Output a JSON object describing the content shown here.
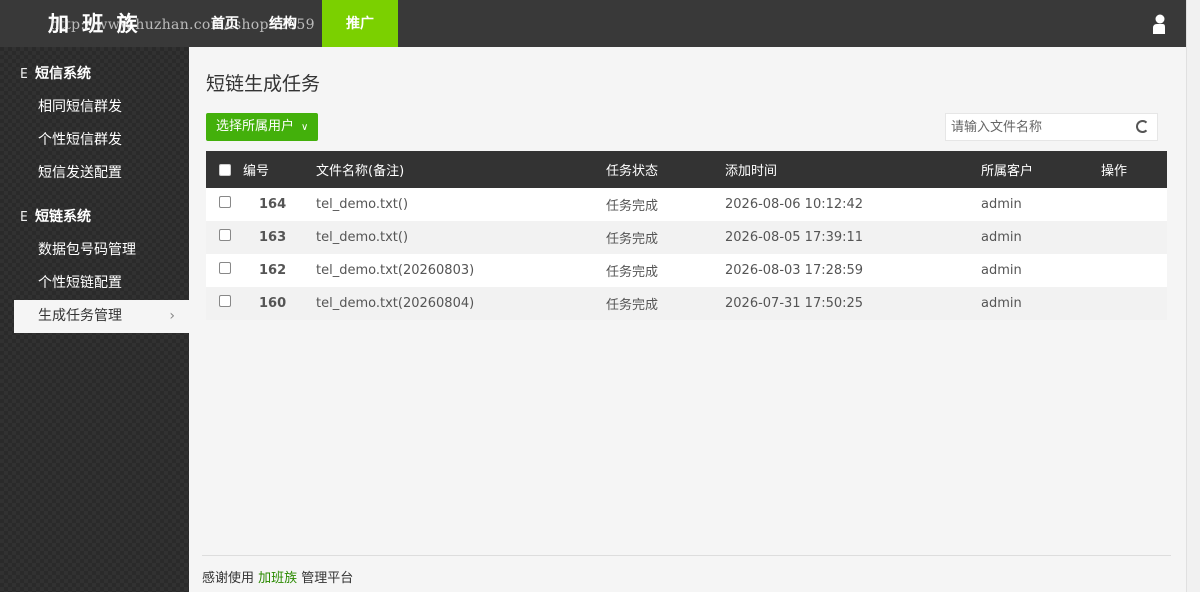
{
  "header": {
    "logo": "加 班 族",
    "watermark": "http://www.huzhan.com/ishop32059",
    "nav": [
      "首页",
      "结构",
      "推广"
    ],
    "active_nav": "推广"
  },
  "sidebar": {
    "groups": [
      {
        "icon": "E",
        "title": "短信系统",
        "items": [
          "相同短信群发",
          "个性短信群发",
          "短信发送配置"
        ]
      },
      {
        "icon": "E",
        "title": "短链系统",
        "items": [
          "数据包号码管理",
          "个性短链配置",
          "生成任务管理"
        ]
      }
    ],
    "active_item": "生成任务管理",
    "active_chevron": "›"
  },
  "main": {
    "title": "短链生成任务",
    "select_label": "选择所属用户",
    "select_caret": "∨",
    "search_placeholder": "请输入文件名称",
    "table": {
      "headers": [
        "编号",
        "文件名称(备注)",
        "任务状态",
        "添加时间",
        "所属客户",
        "操作"
      ],
      "rows": [
        {
          "id": "164",
          "file": "tel_demo.txt()",
          "status": "任务完成",
          "time": "2026-08-06 10:12:42",
          "client": "admin"
        },
        {
          "id": "163",
          "file": "tel_demo.txt()",
          "status": "任务完成",
          "time": "2026-08-05 17:39:11",
          "client": "admin"
        },
        {
          "id": "162",
          "file": "tel_demo.txt(20260803)",
          "status": "任务完成",
          "time": "2026-08-03 17:28:59",
          "client": "admin"
        },
        {
          "id": "160",
          "file": "tel_demo.txt(20260804)",
          "status": "任务完成",
          "time": "2026-07-31 17:50:25",
          "client": "admin"
        }
      ]
    },
    "footer": {
      "prefix": "感谢使用 ",
      "brand": "加班族",
      "suffix": " 管理平台"
    }
  },
  "colors": {
    "topbar": "#393939",
    "accent": "#7bd000",
    "button": "#43b00b",
    "table_header": "#333333"
  }
}
